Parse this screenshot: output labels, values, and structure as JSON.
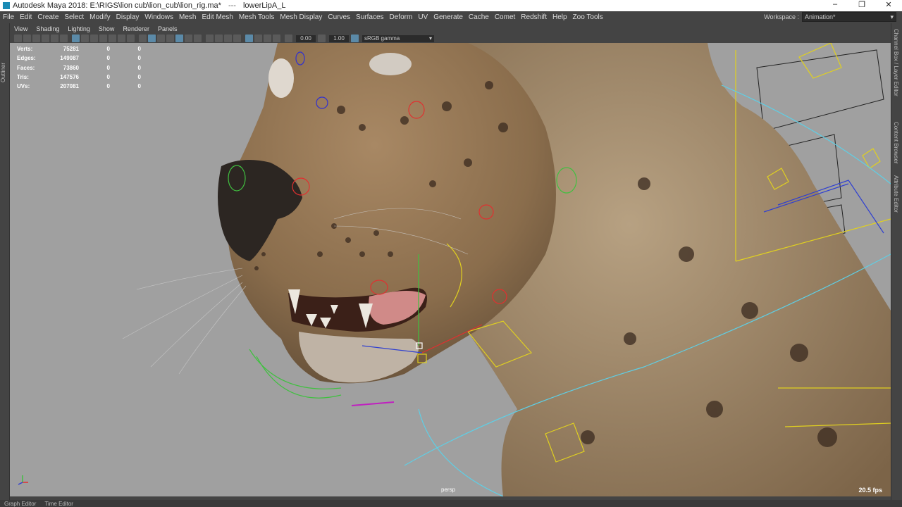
{
  "window": {
    "title": "Autodesk Maya 2018: E:\\RIGS\\lion cub\\lion_cub\\lion_rig.ma*",
    "separator": "---",
    "selection": "lowerLipA_L",
    "controls": [
      "–",
      "❐",
      "✕"
    ]
  },
  "menubar": {
    "items": [
      "File",
      "Edit",
      "Create",
      "Select",
      "Modify",
      "Display",
      "Windows",
      "Mesh",
      "Edit Mesh",
      "Mesh Tools",
      "Mesh Display",
      "Curves",
      "Surfaces",
      "Deform",
      "UV",
      "Generate",
      "Cache",
      "Comet",
      "Redshift",
      "Help",
      "Zoo Tools"
    ],
    "workspace_label": "Workspace :",
    "workspace_value": "Animation*"
  },
  "left_strip": {
    "label": "Outliner"
  },
  "right_strip": {
    "labels": [
      "Channel Box / Layer Editor",
      "Content Browser",
      "Attribute Editor"
    ]
  },
  "panel_menu": {
    "items": [
      "View",
      "Shading",
      "Lighting",
      "Show",
      "Renderer",
      "Panels"
    ]
  },
  "toolbar": {
    "exposure": "0.00",
    "gamma": "1.00",
    "color_space": "sRGB gamma"
  },
  "hud": {
    "rows": [
      {
        "label": "Verts:",
        "v1": "75281",
        "v2": "0",
        "v3": "0"
      },
      {
        "label": "Edges:",
        "v1": "149087",
        "v2": "0",
        "v3": "0"
      },
      {
        "label": "Faces:",
        "v1": "73860",
        "v2": "0",
        "v3": "0"
      },
      {
        "label": "Tris:",
        "v1": "147576",
        "v2": "0",
        "v3": "0"
      },
      {
        "label": "UVs:",
        "v1": "207081",
        "v2": "0",
        "v3": "0"
      }
    ]
  },
  "viewport": {
    "camera": "persp",
    "fps": "20.5 fps"
  },
  "bottom": {
    "tabs": [
      "Graph Editor",
      "Time Editor"
    ]
  },
  "colors": {
    "viewport_bg": "#a0a0a0",
    "ui_bg": "#444444",
    "accent": "#5b8aa8"
  }
}
